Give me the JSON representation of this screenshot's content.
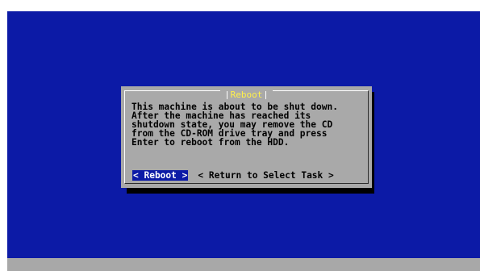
{
  "dialog": {
    "title": "Reboot",
    "message_lines": [
      "This machine is about to be shut down.",
      "After the machine has reached its",
      "shutdown state, you may remove the CD",
      "from the CD-ROM drive tray and press",
      "Enter to reboot from the HDD."
    ],
    "buttons": [
      {
        "label": "< Reboot >",
        "selected": true
      },
      {
        "label": "< Return to Select Task >",
        "selected": false
      }
    ]
  },
  "colors": {
    "console_background": "#0c1aa6",
    "dialog_background": "#a9a9a9",
    "title_color": "#fff04a",
    "selected_button_background": "#0c1aa6",
    "status_bar": "#a8a8a8"
  }
}
